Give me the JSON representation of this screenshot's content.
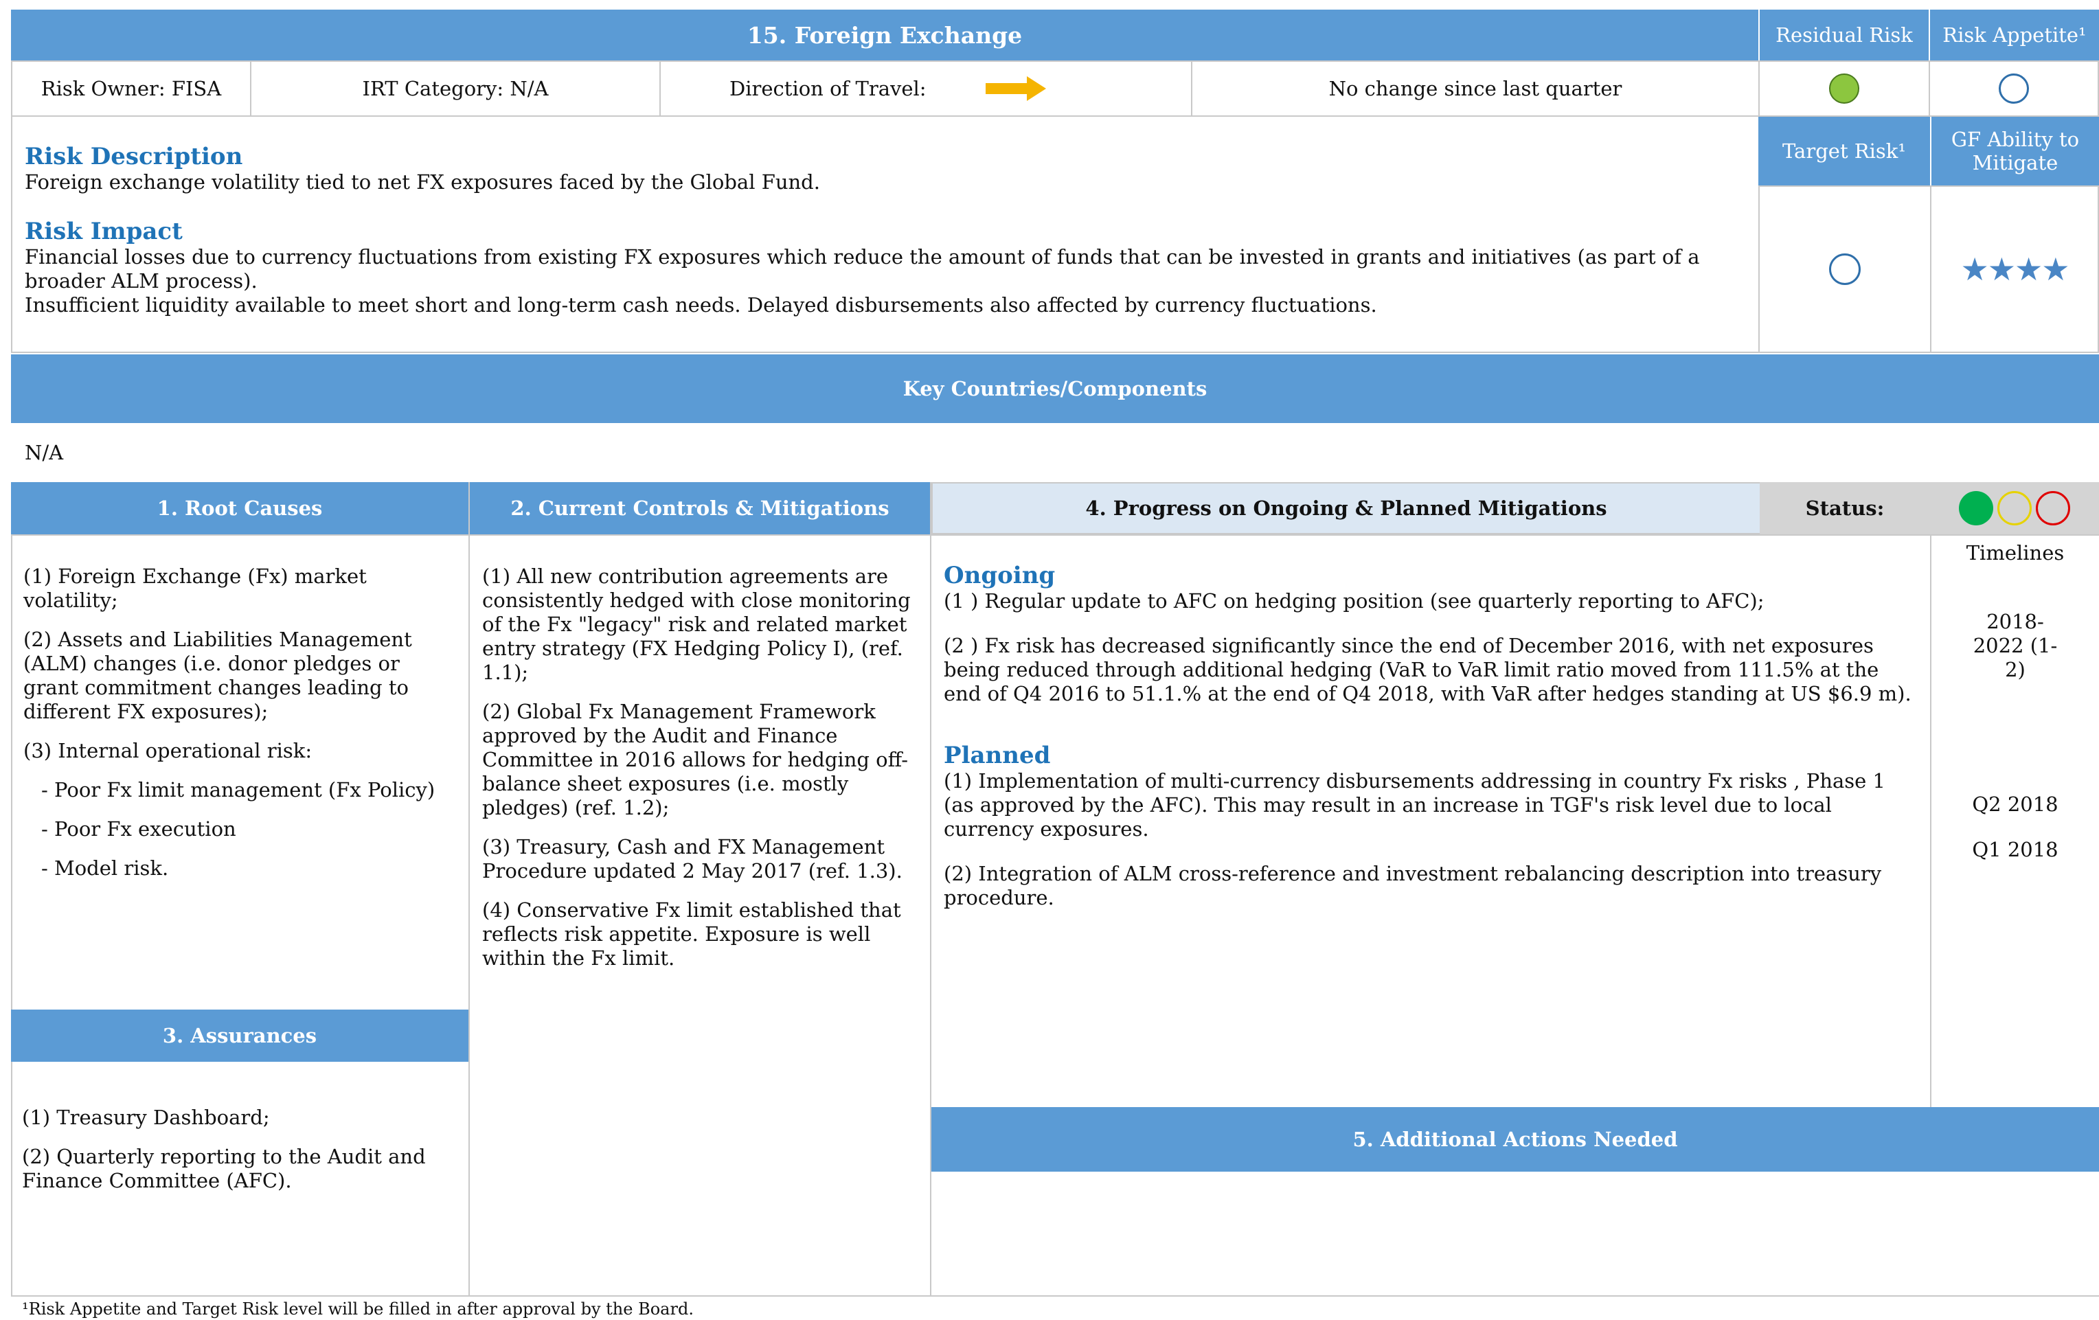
{
  "title": "15. Foreign Exchange",
  "header": {
    "residual_risk": "Residual Risk",
    "risk_appetite": "Risk Appetite¹",
    "target_risk": "Target Risk¹",
    "gf_ability": "GF Ability to Mitigate"
  },
  "info_row": {
    "risk_owner": "Risk Owner:  FISA",
    "irt_category": "IRT Category:  N/A",
    "direction_label": "Direction of Travel:",
    "direction_text": "No change since last quarter"
  },
  "ratings": {
    "residual_color": "#8cc63f",
    "circle_outline": "#2f6faa",
    "gf_ability_stars": 4,
    "star_glyphs": "★★★★",
    "star_color": "#4a86c5",
    "arrow_color": "#f5b400"
  },
  "description": {
    "heading": "Risk Description",
    "text": "Foreign exchange volatility tied to net FX exposures faced by the Global Fund."
  },
  "impact": {
    "heading": "Risk Impact",
    "line1": "Financial losses due to currency fluctuations from existing FX exposures which reduce the amount of funds that can be invested in grants and initiatives (as part of a broader ALM process).",
    "line2": "Insufficient liquidity available to meet short and long-term cash needs. Delayed disbursements also affected by currency fluctuations."
  },
  "key_countries": {
    "heading": "Key Countries/Components",
    "value": "N/A"
  },
  "root_causes": {
    "heading": "1. Root Causes",
    "items": [
      "(1) Foreign Exchange (Fx) market volatility;",
      "(2) Assets and Liabilities Management (ALM) changes (i.e. donor pledges or grant commitment changes leading to different FX exposures);",
      "(3) Internal operational risk:",
      "- Poor Fx limit management (Fx Policy)",
      "- Poor Fx execution",
      "- Model risk."
    ]
  },
  "controls": {
    "heading": "2. Current Controls & Mitigations",
    "items": [
      "(1) All new contribution agreements are consistently hedged with close monitoring of the Fx \"legacy\" risk and related market entry strategy (FX Hedging Policy I), (ref. 1.1);",
      "(2)  Global Fx Management Framework approved by the Audit and Finance Committee in 2016 allows for hedging off-balance sheet exposures (i.e. mostly pledges) (ref. 1.2);",
      "(3) Treasury, Cash and FX Management Procedure updated 2 May 2017 (ref. 1.3).",
      "(4) Conservative Fx limit established that reflects risk appetite. Exposure is well within the Fx limit."
    ]
  },
  "assurances": {
    "heading": "3. Assurances",
    "items": [
      "(1) Treasury Dashboard;",
      "(2) Quarterly reporting to the Audit and Finance Committee (AFC)."
    ]
  },
  "progress": {
    "heading": "4. Progress on Ongoing & Planned Mitigations",
    "status_label": "Status:",
    "status_colors": [
      "#00b050",
      "#ffff00",
      "#ff0000"
    ],
    "timelines_label": "Timelines",
    "ongoing_heading": "Ongoing",
    "ongoing": [
      {
        "text": "(1 ) Regular update to AFC on hedging position (see quarterly reporting to AFC);",
        "timeline": ""
      },
      {
        "text": "(2 ) Fx risk has decreased significantly since the end of December 2016, with net exposures being reduced through additional hedging (VaR to VaR limit ratio moved from 111.5% at the end of Q4 2016 to 51.1.% at the end of Q4 2018, with VaR after hedges standing at US $6.9 m).",
        "timeline": "2018-2022 (1-2)"
      }
    ],
    "planned_heading": "Planned",
    "planned": [
      {
        "text": "(1) Implementation of multi-currency disbursements addressing in country Fx risks , Phase 1 (as approved by the AFC). This may result in an increase in TGF's risk level due to local currency exposures.",
        "timeline": "Q2 2018"
      },
      {
        "text": "(2) Integration of ALM cross-reference and investment rebalancing description into treasury procedure.",
        "timeline": "Q1 2018"
      }
    ]
  },
  "additional_actions": {
    "heading": "5.  Additional Actions Needed"
  },
  "footnote": "¹Risk Appetite and Target Risk level will be filled in after approval by the Board."
}
